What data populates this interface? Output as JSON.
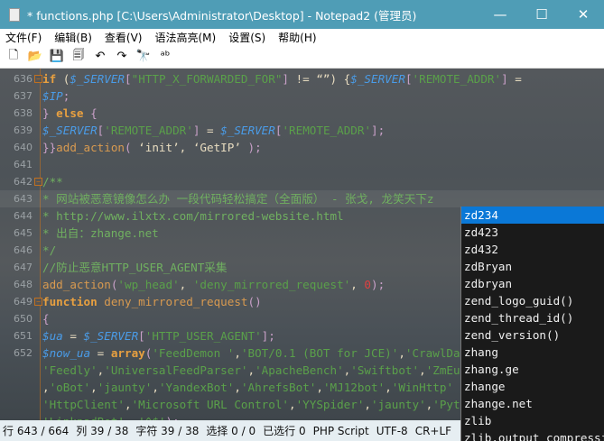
{
  "window": {
    "title": "* functions.php [C:\\Users\\Administrator\\Desktop] - Notepad2 (管理员)",
    "minimize": "—",
    "maximize": "☐",
    "close": "✕"
  },
  "menu": [
    "文件(F)",
    "编辑(B)",
    "查看(V)",
    "语法高亮(M)",
    "设置(S)",
    "帮助(H)"
  ],
  "toolbar": [
    {
      "icon": "new-file-icon",
      "glyph": "🗋"
    },
    {
      "icon": "open-folder-icon",
      "glyph": "📂"
    },
    {
      "icon": "save-icon",
      "glyph": "💾"
    },
    {
      "icon": "save-as-icon",
      "glyph": "🗐"
    },
    {
      "icon": "undo-icon",
      "glyph": "↶"
    },
    {
      "icon": "redo-icon",
      "glyph": "↷"
    },
    {
      "icon": "find-icon",
      "glyph": "🔭"
    },
    {
      "icon": "replace-icon",
      "glyph": "ᵃᵇ"
    }
  ],
  "editor": {
    "lines": [
      {
        "n": "636",
        "fold": "⊟",
        "t": [
          [
            "kw",
            "if"
          ],
          [
            "tx",
            " ("
          ],
          [
            "var",
            "$_SERVER"
          ],
          [
            "op",
            "["
          ],
          [
            "str",
            "\"HTTP_X_FORWARDED_FOR\""
          ],
          [
            "op",
            "]"
          ],
          [
            "tx",
            " != “”) {"
          ],
          [
            "var",
            "$_SERVER"
          ],
          [
            "op",
            "["
          ],
          [
            "str",
            "'REMOTE_ADDR'"
          ],
          [
            "op",
            "]"
          ],
          [
            "tx",
            " ="
          ]
        ]
      },
      {
        "n": "637",
        "t": [
          [
            "var",
            "$IP"
          ],
          [
            "op",
            ";"
          ]
        ]
      },
      {
        "n": "638",
        "t": [
          [
            "op",
            "} "
          ],
          [
            "kw",
            "else"
          ],
          [
            "op",
            " {"
          ]
        ]
      },
      {
        "n": "639",
        "t": [
          [
            "var",
            "$_SERVER"
          ],
          [
            "op",
            "["
          ],
          [
            "str",
            "'REMOTE_ADDR'"
          ],
          [
            "op",
            "]"
          ],
          [
            "tx",
            " = "
          ],
          [
            "var",
            "$_SERVER"
          ],
          [
            "op",
            "["
          ],
          [
            "str",
            "'REMOTE_ADDR'"
          ],
          [
            "op",
            "];"
          ]
        ]
      },
      {
        "n": "640",
        "t": [
          [
            "op",
            "}}"
          ],
          [
            "fn",
            "add_action"
          ],
          [
            "op",
            "("
          ],
          [
            "tx",
            " ‘init’, ‘GetIP’ "
          ],
          [
            "op",
            ");"
          ]
        ]
      },
      {
        "n": "641",
        "t": []
      },
      {
        "n": "642",
        "fold": "⊟",
        "t": [
          [
            "cm",
            "/**"
          ]
        ]
      },
      {
        "n": "643",
        "cur": true,
        "t": [
          [
            "cm",
            "* 网站被恶意镜像怎么办 一段代码轻松搞定（全面版） - 张戈, 龙笑天下z"
          ]
        ]
      },
      {
        "n": "644",
        "t": [
          [
            "cm",
            "* http://www.ilxtx.com/mirrored-website.html"
          ]
        ]
      },
      {
        "n": "645",
        "t": [
          [
            "cm",
            "* 出自：zhange.net"
          ]
        ]
      },
      {
        "n": "646",
        "t": [
          [
            "cm",
            "*/"
          ]
        ]
      },
      {
        "n": "647",
        "t": [
          [
            "cm",
            "//防止恶意HTTP_USER_AGENT采集"
          ]
        ]
      },
      {
        "n": "648",
        "t": [
          [
            "fn",
            "add_action"
          ],
          [
            "op",
            "("
          ],
          [
            "str",
            "'wp_head'"
          ],
          [
            "tx",
            ", "
          ],
          [
            "str",
            "'deny_mirrored_request'"
          ],
          [
            "tx",
            ", "
          ],
          [
            "num",
            "0"
          ],
          [
            "op",
            ");"
          ]
        ]
      },
      {
        "n": "649",
        "fold": "⊟",
        "t": [
          [
            "kw",
            "function"
          ],
          [
            "fn",
            " deny_mirrored_request"
          ],
          [
            "op",
            "()"
          ]
        ]
      },
      {
        "n": "650",
        "t": [
          [
            "op",
            "{"
          ]
        ]
      },
      {
        "n": "651",
        "t": [
          [
            "var",
            "$ua"
          ],
          [
            "tx",
            " = "
          ],
          [
            "var",
            "$_SERVER"
          ],
          [
            "op",
            "["
          ],
          [
            "str",
            "'HTTP_USER_AGENT'"
          ],
          [
            "op",
            "];"
          ]
        ]
      },
      {
        "n": "652",
        "t": [
          [
            "var",
            "$now_ua"
          ],
          [
            "tx",
            " = "
          ],
          [
            "kw",
            "array"
          ],
          [
            "op",
            "("
          ],
          [
            "str",
            "'FeedDemon '"
          ],
          [
            "tx",
            ","
          ],
          [
            "str",
            "'BOT/0.1 (BOT for JCE)'"
          ],
          [
            "tx",
            ","
          ],
          [
            "str",
            "'CrawlDaddy'"
          ]
        ]
      },
      {
        "n": "",
        "t": [
          [
            "str",
            "'Feedly'"
          ],
          [
            "tx",
            ","
          ],
          [
            "str",
            "'UniversalFeedParser'"
          ],
          [
            "tx",
            ","
          ],
          [
            "str",
            "'ApacheBench'"
          ],
          [
            "tx",
            ","
          ],
          [
            "str",
            "'Swiftbot'"
          ],
          [
            "tx",
            ","
          ],
          [
            "str",
            "'ZmEu'"
          ]
        ]
      },
      {
        "n": "",
        "t": [
          [
            "tx",
            ","
          ],
          [
            "str",
            "'oBot'"
          ],
          [
            "tx",
            ","
          ],
          [
            "str",
            "'jaunty'"
          ],
          [
            "tx",
            ","
          ],
          [
            "str",
            "'YandexBot'"
          ],
          [
            "tx",
            ","
          ],
          [
            "str",
            "'AhrefsBot'"
          ],
          [
            "tx",
            ","
          ],
          [
            "str",
            "'MJ12bot'"
          ],
          [
            "tx",
            ","
          ],
          [
            "str",
            "'WinHttp'"
          ]
        ]
      },
      {
        "n": "",
        "t": [
          [
            "str",
            "'HttpClient'"
          ],
          [
            "tx",
            ","
          ],
          [
            "str",
            "'Microsoft URL Control'"
          ],
          [
            "tx",
            ","
          ],
          [
            "str",
            "'YYSpider'"
          ],
          [
            "tx",
            ","
          ],
          [
            "str",
            "'jaunty'"
          ],
          [
            "tx",
            ","
          ],
          [
            "str",
            "'Python'"
          ]
        ]
      },
      {
        "n": "",
        "t": [
          [
            "str",
            "'LinkpadBot'"
          ],
          [
            "tx",
            ", "
          ],
          [
            "str",
            "'^$'"
          ],
          [
            "op",
            ");"
          ]
        ]
      }
    ]
  },
  "autocomplete": {
    "selected": 0,
    "items": [
      "zd234",
      "zd423",
      "zd432",
      "zdBryan",
      "zdbryan",
      "zend_logo_guid()",
      "zend_thread_id()",
      "zend_version()",
      "zhang",
      "zhang.ge",
      "zhange",
      "zhange.net",
      "zlib",
      "zlib.output_compression"
    ]
  },
  "status": [
    "行 643 / 664",
    "列 39 / 38",
    "字符 39 / 38",
    "选择 0 / 0",
    "已选行 0",
    "PHP Script",
    "UTF-8",
    "CR+LF"
  ],
  "colors": {
    "titlebar": "#4f9db6",
    "selection": "#0a78d7",
    "variable": "#4a9ce8",
    "keyword": "#e8a040",
    "string": "#5aa04a"
  }
}
